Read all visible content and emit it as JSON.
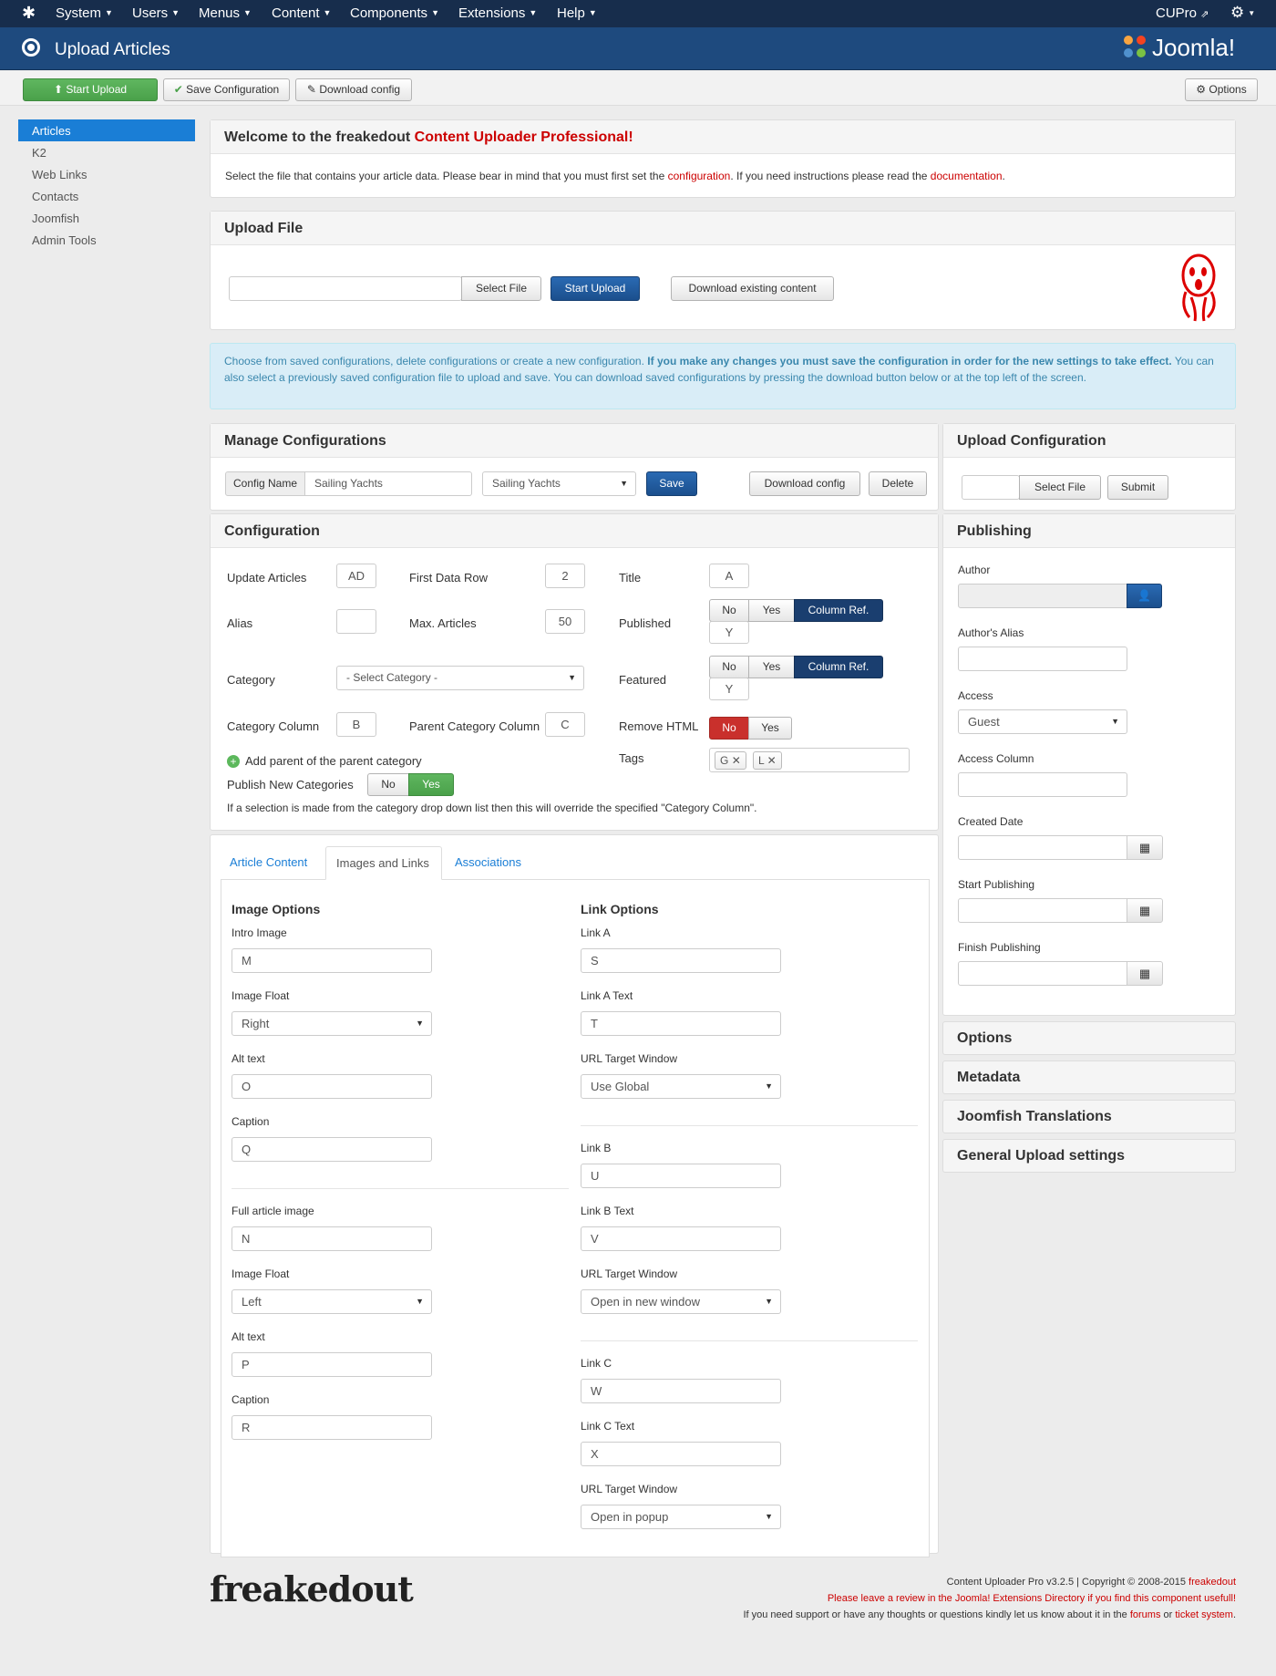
{
  "navbar": {
    "menu": [
      "System",
      "Users",
      "Menus",
      "Content",
      "Components",
      "Extensions",
      "Help"
    ],
    "user": "CUPro",
    "logo_icon": "joomla-icon",
    "settings_icon": "gear-icon"
  },
  "header": {
    "title": "Upload Articles",
    "brand": "Joomla!"
  },
  "toolbar": {
    "start_upload": "Start Upload",
    "save_configuration": "Save Configuration",
    "download_config": "Download config",
    "options": "Options"
  },
  "sidebar": {
    "items": [
      "Articles",
      "K2",
      "Web Links",
      "Contacts",
      "Joomfish",
      "Admin Tools"
    ],
    "active": "Articles"
  },
  "welcome": {
    "title_prefix": "Welcome to the freakedout",
    "title_highlight": "Content Uploader Professional!",
    "text1": "Select the file that contains your article data. Please bear in mind that you must first set the",
    "link1": "configuration",
    "text2": ". If you need instructions please read the",
    "link2": "documentation",
    "text3": "."
  },
  "upload_file": {
    "title": "Upload File",
    "select_file": "Select File",
    "start_upload": "Start Upload",
    "download_existing": "Download existing content"
  },
  "info": {
    "text1": "Choose from saved configurations, delete configurations or create a new configuration.",
    "bold": "If you make any changes you must save the configuration in order for the new settings to take effect.",
    "text2": "You can also select a previously saved configuration file to upload and save. You can download saved configurations by pressing the download button below or at the top left of the screen."
  },
  "manage": {
    "title": "Manage Configurations",
    "config_name_label": "Config Name",
    "config_name_value": "Sailing Yachts",
    "select_value": "Sailing Yachts",
    "save": "Save",
    "download_config": "Download config",
    "delete": "Delete"
  },
  "upload_config": {
    "title": "Upload Configuration",
    "select_file": "Select File",
    "submit": "Submit"
  },
  "configuration": {
    "title": "Configuration",
    "update_articles": "Update Articles",
    "update_articles_value": "AD",
    "first_data_row": "First Data Row",
    "first_data_row_value": "2",
    "title_label": "Title",
    "title_value": "A",
    "alias": "Alias",
    "max_articles": "Max. Articles",
    "max_articles_value": "50",
    "published": "Published",
    "no": "No",
    "yes": "Yes",
    "column_ref": "Column Ref.",
    "published_value": "Y",
    "category": "Category",
    "category_value": "- Select Category -",
    "featured": "Featured",
    "featured_value": "Y",
    "category_column": "Category Column",
    "category_column_value": "B",
    "parent_category_column": "Parent Category Column",
    "parent_category_column_value": "C",
    "remove_html": "Remove HTML",
    "add_parent": "Add parent of the parent category",
    "tags": "Tags",
    "tag1": "G",
    "tag2": "L",
    "publish_new_categories": "Publish New Categories",
    "note": "If a selection is made from the category drop down list then this will override the specified \"Category Column\"."
  },
  "tabs": {
    "items": [
      "Article Content",
      "Images and Links",
      "Associations"
    ],
    "active": "Images and Links"
  },
  "images": {
    "title": "Image Options",
    "intro_image": "Intro Image",
    "intro_image_value": "M",
    "image_float": "Image Float",
    "intro_float_value": "Right",
    "alt_text": "Alt text",
    "intro_alt_value": "O",
    "caption": "Caption",
    "intro_caption_value": "Q",
    "full_image": "Full article image",
    "full_image_value": "N",
    "full_float_value": "Left",
    "full_alt_value": "P",
    "full_caption_value": "R"
  },
  "links": {
    "title": "Link Options",
    "link_a": "Link A",
    "link_a_value": "S",
    "link_a_text": "Link A Text",
    "link_a_text_value": "T",
    "url_target": "URL Target Window",
    "link_a_target": "Use Global",
    "link_b": "Link B",
    "link_b_value": "U",
    "link_b_text": "Link B Text",
    "link_b_text_value": "V",
    "link_b_target": "Open in new window",
    "link_c": "Link C",
    "link_c_value": "W",
    "link_c_text": "Link C Text",
    "link_c_text_value": "X",
    "link_c_target": "Open in popup"
  },
  "publishing": {
    "title": "Publishing",
    "author": "Author",
    "authors_alias": "Author's Alias",
    "access": "Access",
    "access_value": "Guest",
    "access_column": "Access Column",
    "created_date": "Created Date",
    "start_publishing": "Start Publishing",
    "finish_publishing": "Finish Publishing"
  },
  "accordions": [
    "Options",
    "Metadata",
    "Joomfish Translations",
    "General Upload settings"
  ],
  "footer": {
    "logo": "freakedout",
    "line1": "Content Uploader Pro v3.2.5 | Copyright © 2008-2015",
    "line1_link": "freakedout",
    "line2": "Please leave a review in the Joomla! Extensions Directory if you find this component usefull!",
    "line3a": "If you need support or have any thoughts or questions kindly let us know about it in the",
    "line3_link1": "forums",
    "line3b": "or",
    "line3_link2": "ticket system",
    "line3c": "."
  },
  "colors": {
    "navbar": "#172d4c",
    "header": "#1e4a7e",
    "accent": "#1a7ed6",
    "link": "#cc0000",
    "green": "#4aa14a"
  }
}
